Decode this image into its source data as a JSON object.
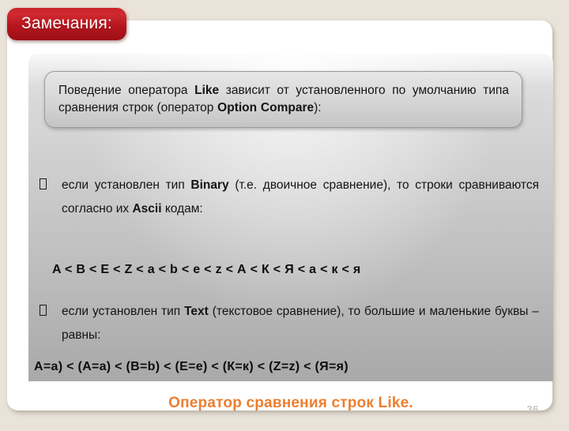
{
  "slide": {
    "badge_label": "Замечания:",
    "callout": {
      "part1": "Поведение оператора ",
      "bold1": "Like",
      "part2": " зависит от установленного по умолчанию типа сравнения строк (оператор ",
      "bold2": "Option Compare",
      "part3": "):"
    },
    "bullets": [
      {
        "marker": "missing-glyph-box",
        "part1": "если установлен тип ",
        "bold": "Binary",
        "part2": " (т.е. двоичное сравнение), то строки сравниваются согласно их ",
        "bold2": "Ascii",
        "part3": " кодам:"
      },
      {
        "marker": "missing-glyph-box",
        "part1": "если установлен тип ",
        "bold": "Text",
        "part2": " (текстовое сравнение), то большие и маленькие буквы – равны:"
      }
    ],
    "formula_ascii": "A < B < E < Z < a < b < e < z < А < К < Я < а < к < я",
    "formula_equal": "A=a) < (А=а) < (B=b) < (E=e) < (К=к) < (Z=z) < (Я=я)",
    "footer_title": "Оператор сравнения строк Like.",
    "page_number": "36"
  },
  "colors": {
    "background": "#e9e3d9",
    "badge_red": "#b4151d",
    "footer_orange": "#ec7e30",
    "panel_gray": "#c9c9c9",
    "page_number_gray": "#c9c4bc"
  }
}
